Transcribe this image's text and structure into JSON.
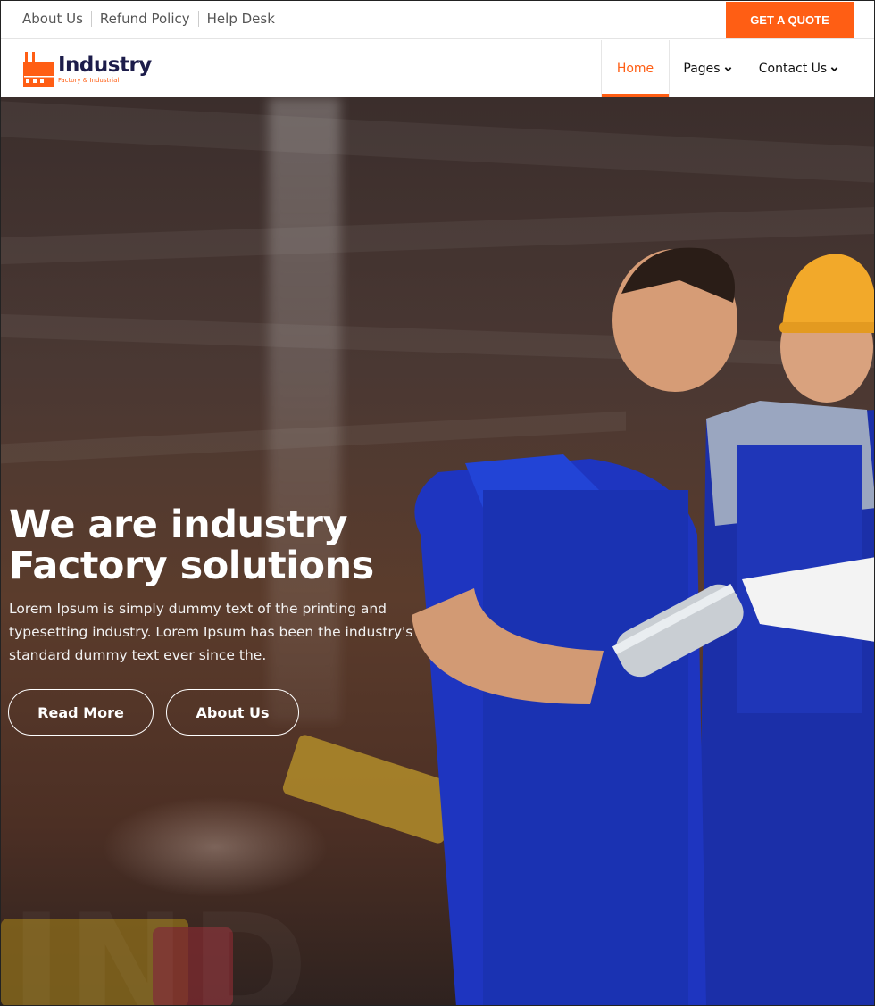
{
  "topbar": {
    "links": [
      "About Us",
      "Refund Policy",
      "Help Desk"
    ],
    "quote_label": "GET A QUOTE"
  },
  "brand": {
    "name": "Industry",
    "tagline": "Factory & Industrial"
  },
  "nav": {
    "items": [
      {
        "label": "Home",
        "active": true
      },
      {
        "label": "Pages",
        "has_dropdown": true
      },
      {
        "label": "Contact Us",
        "has_dropdown": true
      }
    ]
  },
  "hero": {
    "title_line1": "We are industry",
    "title_line2": "Factory solutions",
    "text": "Lorem Ipsum is simply dummy text of the printing and typesetting industry. Lorem Ipsum has been the industry's standard dummy text ever since the.",
    "buttons": [
      "Read More",
      "About Us"
    ]
  },
  "colors": {
    "accent": "#ff5e14",
    "brand_dark": "#1c1c4a"
  },
  "icons": {
    "logo": "factory-icon",
    "dropdown": "chevron-down-icon"
  }
}
